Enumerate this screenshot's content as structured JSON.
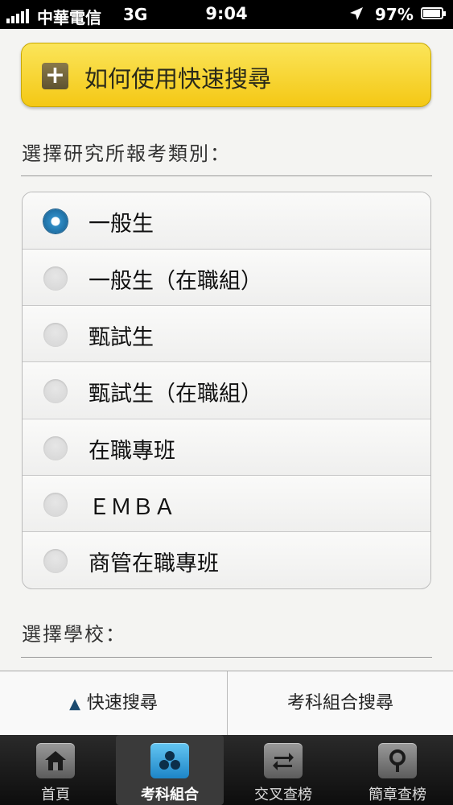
{
  "status_bar": {
    "carrier": "中華電信",
    "network": "3G",
    "time": "9:04",
    "battery_percent": "97%"
  },
  "help_banner": {
    "title": "如何使用快速搜尋"
  },
  "category_section": {
    "label": "選擇研究所報考類別：",
    "selected_index": 0,
    "options": [
      {
        "label": "一般生"
      },
      {
        "label": "一般生（在職組）"
      },
      {
        "label": "甄試生"
      },
      {
        "label": "甄試生（在職組）"
      },
      {
        "label": "在職專班"
      },
      {
        "label": "ＥＭＢＡ"
      },
      {
        "label": "商管在職專班"
      }
    ]
  },
  "school_section": {
    "label": "選擇學校："
  },
  "search_tabs": {
    "quick": "快速搜尋",
    "quick_arrow": "▲",
    "combo": "考科組合搜尋"
  },
  "tab_bar": {
    "items": [
      {
        "label": "首頁",
        "icon": "home-icon"
      },
      {
        "label": "考科組合",
        "icon": "subject-combo-icon"
      },
      {
        "label": "交叉查榜",
        "icon": "swap-icon"
      },
      {
        "label": "簡章查榜",
        "icon": "magnifier-icon"
      }
    ],
    "active_index": 1
  },
  "colors": {
    "banner": "#f4c815",
    "radio_selected": "#2f8bc4",
    "active_tab_icon": "#1d85c7"
  }
}
